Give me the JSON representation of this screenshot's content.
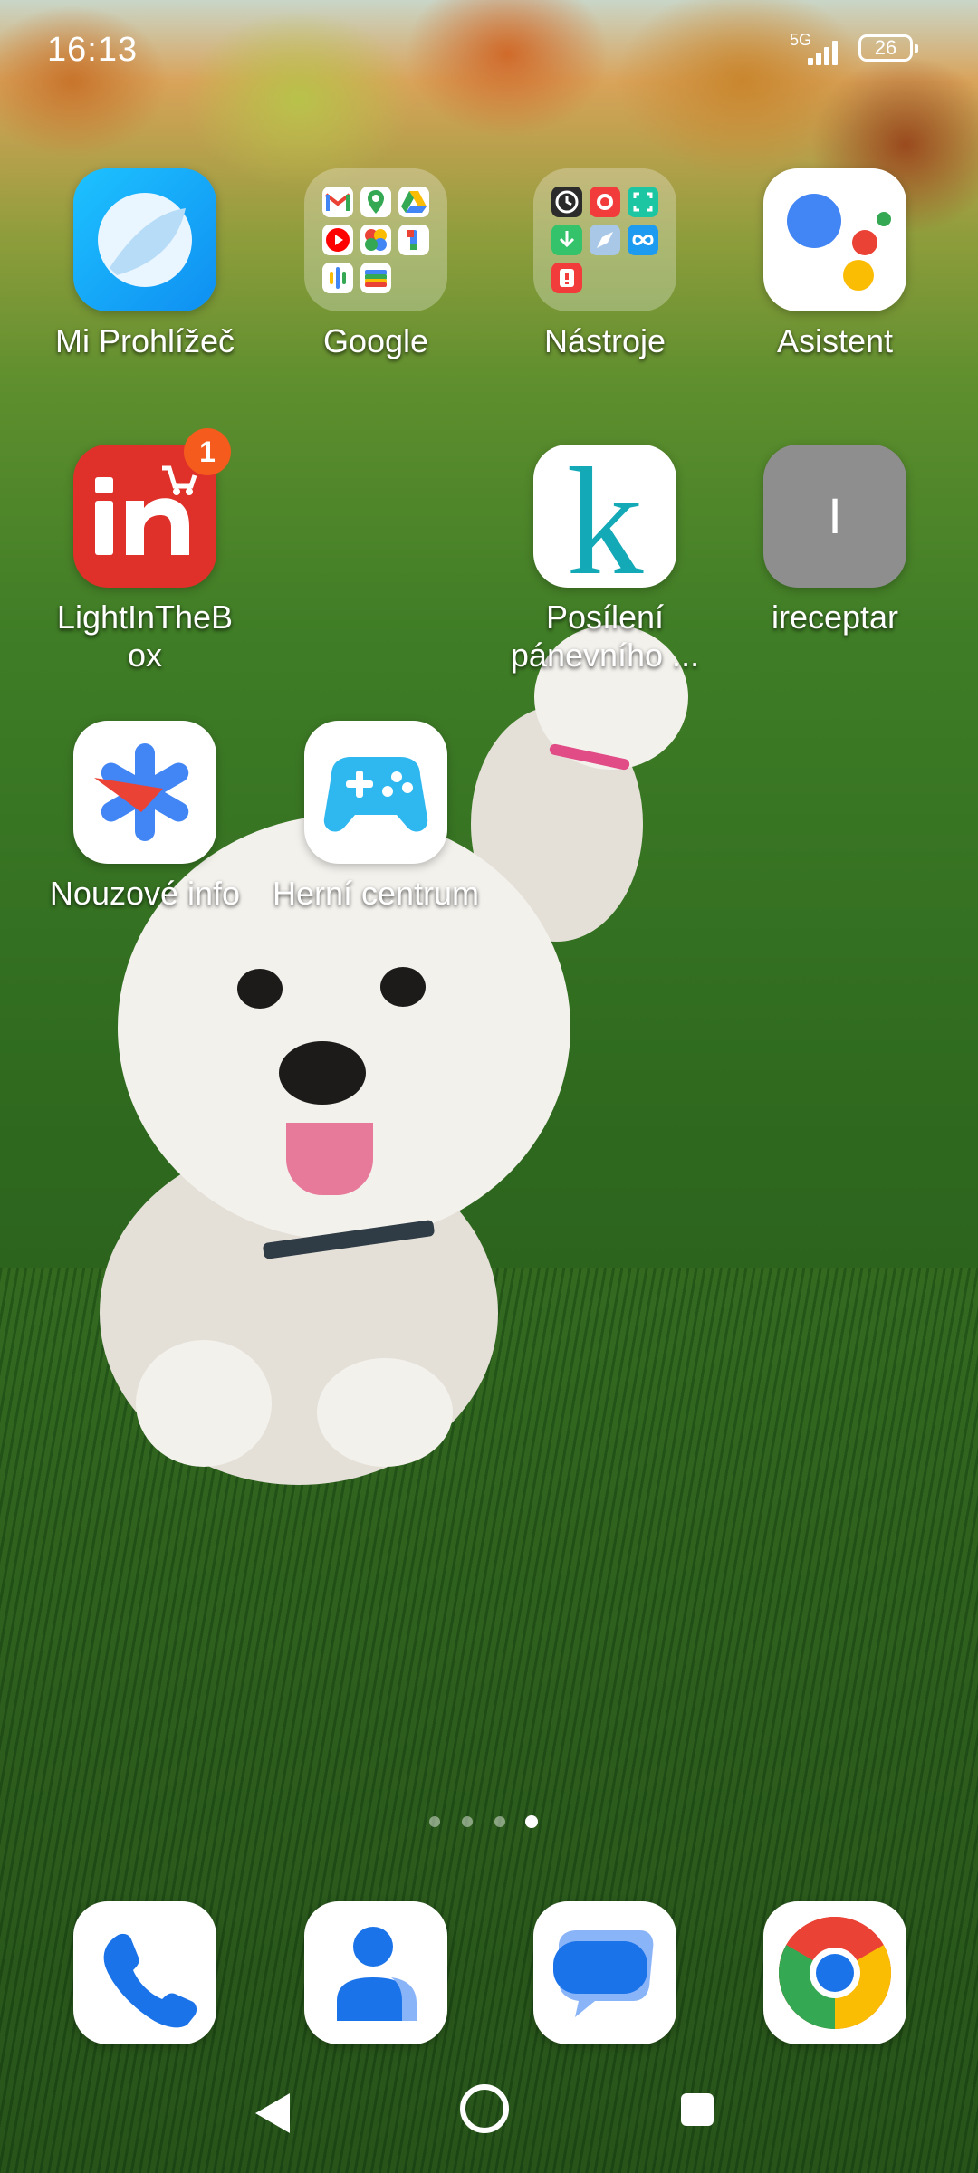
{
  "status_bar": {
    "time": "16:13",
    "network": "5G",
    "battery": "26"
  },
  "apps": [
    {
      "id": "mi-browser",
      "label": "Mi Prohlížeč"
    },
    {
      "id": "google-folder",
      "label": "Google"
    },
    {
      "id": "tools-folder",
      "label": "Nástroje"
    },
    {
      "id": "assistant",
      "label": "Asistent"
    },
    {
      "id": "lightinthebox",
      "label": "LightInTheB ox",
      "badge": "1"
    },
    {
      "id": "posileni",
      "label": "Posílení pánevního ..."
    },
    {
      "id": "ireceptar",
      "label": "ireceptar",
      "icon_letter": "I"
    },
    {
      "id": "emergency-info",
      "label": "Nouzové info"
    },
    {
      "id": "game-center",
      "label": "Herní centrum"
    }
  ],
  "dock": [
    {
      "id": "phone",
      "icon": "phone-icon"
    },
    {
      "id": "contacts",
      "icon": "contacts-icon"
    },
    {
      "id": "messages",
      "icon": "messages-icon"
    },
    {
      "id": "chrome",
      "icon": "chrome-icon"
    }
  ],
  "page_indicator": {
    "pages": 4,
    "active": 4
  },
  "navbar": {
    "buttons": [
      "back-icon",
      "home-icon",
      "recents-icon"
    ]
  },
  "colors": {
    "badge": "#f45b1d",
    "lightinthebox": "#e0302a",
    "mi_browser": "#1aa3f5",
    "game_center": "#2fb7f0",
    "ireceptar": "#8e8e8e"
  }
}
